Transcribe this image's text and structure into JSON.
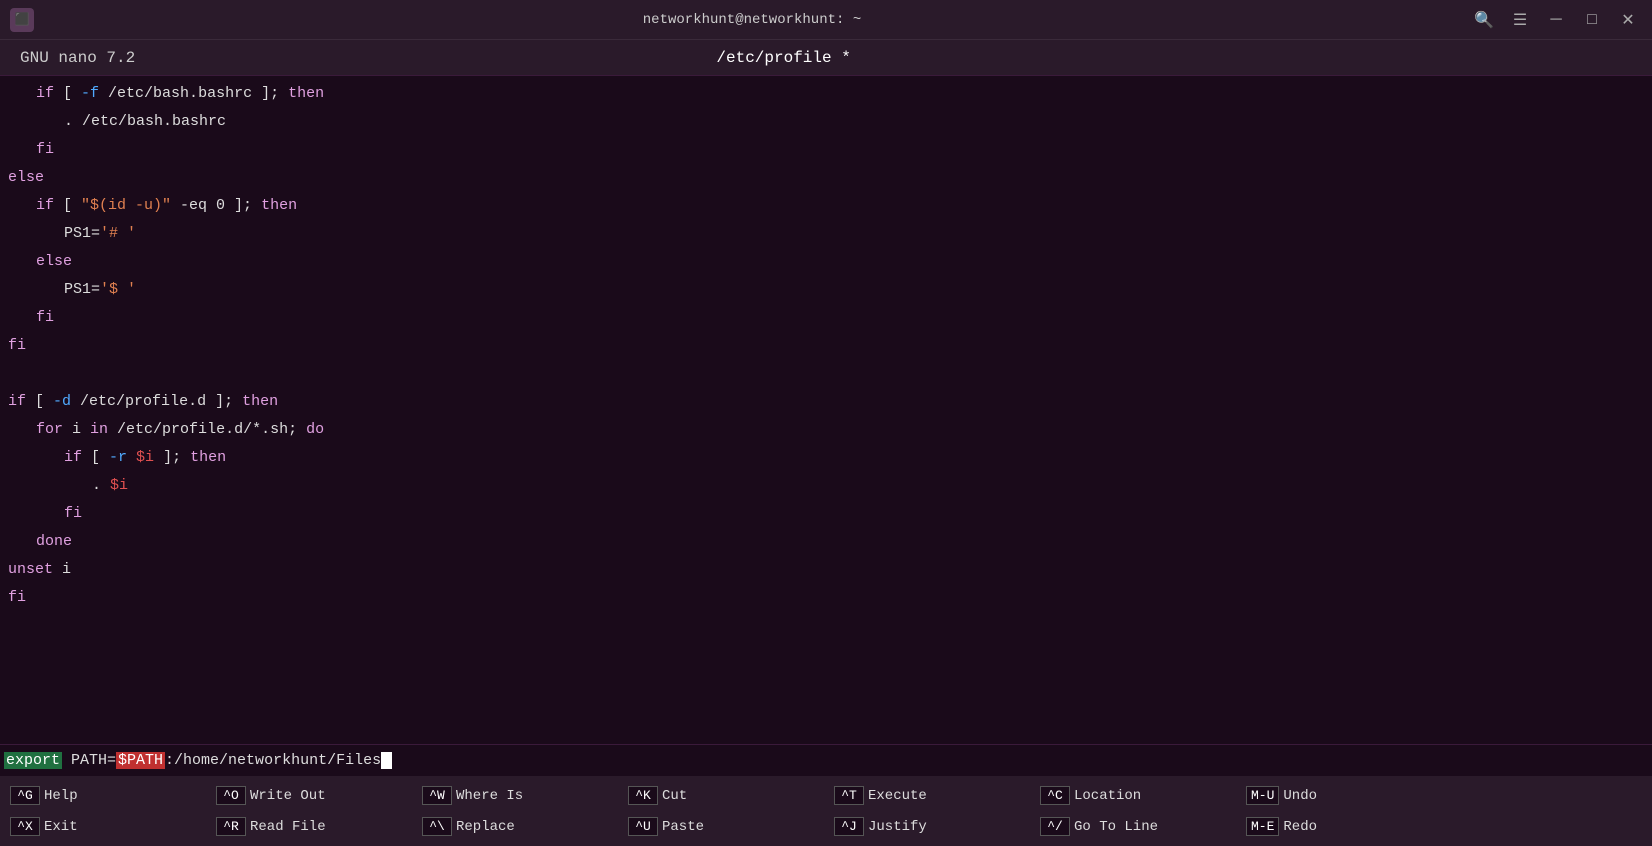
{
  "titlebar": {
    "title": "networkhunt@networkhunt: ~",
    "app_icon": "≡"
  },
  "nano_header": {
    "left": "GNU nano 7.2",
    "center": "/etc/profile *"
  },
  "code": {
    "lines": [
      {
        "indent": 1,
        "content": "if_block_1"
      },
      {
        "indent": 2,
        "content": "source_bashrc"
      },
      {
        "indent": 1,
        "content": "fi_1"
      },
      {
        "indent": 0,
        "content": "else_1"
      },
      {
        "indent": 1,
        "content": "if_block_2"
      },
      {
        "indent": 2,
        "content": "ps1_hash"
      },
      {
        "indent": 1,
        "content": "else_2"
      },
      {
        "indent": 2,
        "content": "ps1_dollar"
      },
      {
        "indent": 1,
        "content": "fi_2"
      },
      {
        "indent": 0,
        "content": "fi_3"
      },
      {
        "indent": 0,
        "content": "blank"
      },
      {
        "indent": 0,
        "content": "if_profile_d"
      },
      {
        "indent": 1,
        "content": "for_loop"
      },
      {
        "indent": 2,
        "content": "if_readable"
      },
      {
        "indent": 3,
        "content": "source_i"
      },
      {
        "indent": 2,
        "content": "fi_4"
      },
      {
        "indent": 1,
        "content": "done"
      },
      {
        "indent": 0,
        "content": "unset_i"
      },
      {
        "indent": 0,
        "content": "fi_5"
      },
      {
        "indent": 0,
        "content": "export_path"
      }
    ]
  },
  "command_line": {
    "export_start": "export",
    "path_eq": " PATH=",
    "path_var": "$PATH",
    "path_rest": ":/home/networkhunt/Files"
  },
  "shortcuts": {
    "row1": [
      {
        "key": "^G",
        "label": "Help"
      },
      {
        "key": "^O",
        "label": "Write Out"
      },
      {
        "key": "^W",
        "label": "Where Is"
      },
      {
        "key": "^K",
        "label": "Cut"
      },
      {
        "key": "^T",
        "label": "Execute"
      },
      {
        "key": "^C",
        "label": "Location"
      },
      {
        "key": "M-U",
        "label": "Undo"
      }
    ],
    "row2": [
      {
        "key": "^X",
        "label": "Exit"
      },
      {
        "key": "^R",
        "label": "Read File"
      },
      {
        "key": "^\\",
        "label": "Replace"
      },
      {
        "key": "^U",
        "label": "Paste"
      },
      {
        "key": "^J",
        "label": "Justify"
      },
      {
        "key": "^/",
        "label": "Go To Line"
      },
      {
        "key": "M-E",
        "label": "Redo"
      }
    ]
  }
}
